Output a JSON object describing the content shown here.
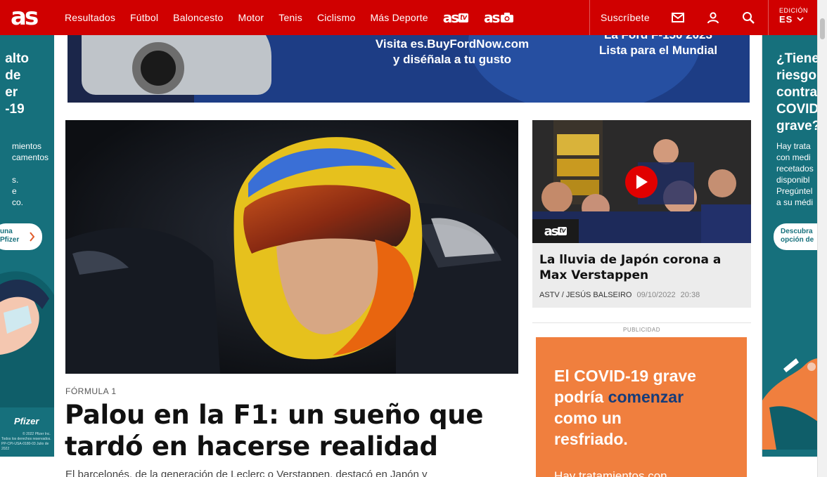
{
  "header": {
    "logo": "as",
    "nav_items": [
      "Resultados",
      "Fútbol",
      "Baloncesto",
      "Motor",
      "Tenis",
      "Ciclismo",
      "Más Deporte"
    ],
    "brand_tv": {
      "as": "as",
      "suffix": "tv"
    },
    "brand_photo": {
      "as": "as"
    },
    "subscribe_label": "Suscríbete",
    "edition_label": "EDICIÓN",
    "edition_value": "ES"
  },
  "banner_ad": {
    "line1": "Visita es.BuyFordNow.com",
    "line2": "y diséñala a tu gusto",
    "line3": "La Ford F-150 2023",
    "line4": "Lista para el Mundial"
  },
  "left_ad": {
    "headline": [
      "alto",
      "de",
      "er",
      "-19"
    ],
    "body": [
      "mientos",
      "camentos",
      "",
      "s.",
      "e",
      "co."
    ],
    "cta": [
      "una",
      "Pfizer"
    ],
    "brand": "Pfizer",
    "fineprint": [
      "© 2022 Pfizer Inc.",
      "Todos los derechos reservados.",
      "PP-CPI-USA-0180-03 Julio de 2022"
    ]
  },
  "right_ad": {
    "headline": [
      "¿Tiene",
      "riesgo",
      "contra",
      "COVID",
      "grave?"
    ],
    "body": [
      "Hay trata",
      "con medi",
      "recetados",
      "disponibl",
      "Pregúntel",
      "a su médi"
    ],
    "cta": [
      "Descubra",
      "opción de"
    ]
  },
  "main_article": {
    "kicker": "FÓRMULA 1",
    "title": "Palou en la F1: un sueño que tardó en hacerse realidad",
    "lead": "El barcelonés, de la generación de Leclerc o Verstappen, destacó en Japón y"
  },
  "video_card": {
    "badge": {
      "as": "as",
      "suffix": "tv"
    },
    "title": "La lluvia de Japón corona a Max Verstappen",
    "section": "ASTV",
    "author": "JESÚS BALSEIRO",
    "date": "09/10/2022",
    "time": "20:38"
  },
  "ad_label": "PUBLICIDAD",
  "promo_ad": {
    "line1": "El COVID-19 grave",
    "line2_a": "podría ",
    "line2_b": "comenzar",
    "line3": "como un",
    "line4": "resfriado.",
    "line5": "Hay tratamientos con"
  },
  "colors": {
    "brand_red": "#d00000",
    "pfizer_teal": "#16707c",
    "promo_orange": "#f07f3e",
    "promo_blue": "#153c7a",
    "ford_blue": "#1d3d85",
    "play_red": "#e10000"
  },
  "icons": {
    "mail": "mail-icon",
    "user": "user-icon",
    "search": "search-icon",
    "edition_chevron": "chevron-down-icon",
    "play": "play-icon",
    "ad_arrow": "chevron-right-icon"
  }
}
